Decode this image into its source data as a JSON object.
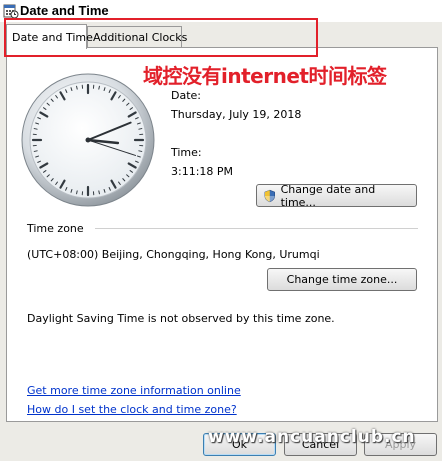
{
  "window": {
    "title": "Date and Time",
    "icon": "calendar-clock-icon"
  },
  "tabs": [
    {
      "label": "Date and Time",
      "selected": true
    },
    {
      "label": "Additional Clocks",
      "selected": false
    }
  ],
  "annotation": {
    "text": "域控没有internet时间标签",
    "color": "#e2202a"
  },
  "clock": {
    "hour": 3,
    "minute": 11,
    "second": 18
  },
  "date": {
    "label": "Date:",
    "value": "Thursday, July 19, 2018"
  },
  "time": {
    "label": "Time:",
    "value": "3:11:18 PM"
  },
  "buttons": {
    "change_date_time": "Change date and time...",
    "change_time_zone": "Change time zone...",
    "ok": "Ok",
    "cancel": "Cancel",
    "apply": "Apply"
  },
  "timezone": {
    "heading": "Time zone",
    "value": "(UTC+08:00) Beijing, Chongqing, Hong Kong, Urumqi",
    "dst_note": "Daylight Saving Time is not observed by this time zone."
  },
  "links": {
    "more_info": "Get more time zone information online",
    "how_to_set": "How do I set the clock and time zone?"
  },
  "watermark": "www.ancuanclub.cn"
}
